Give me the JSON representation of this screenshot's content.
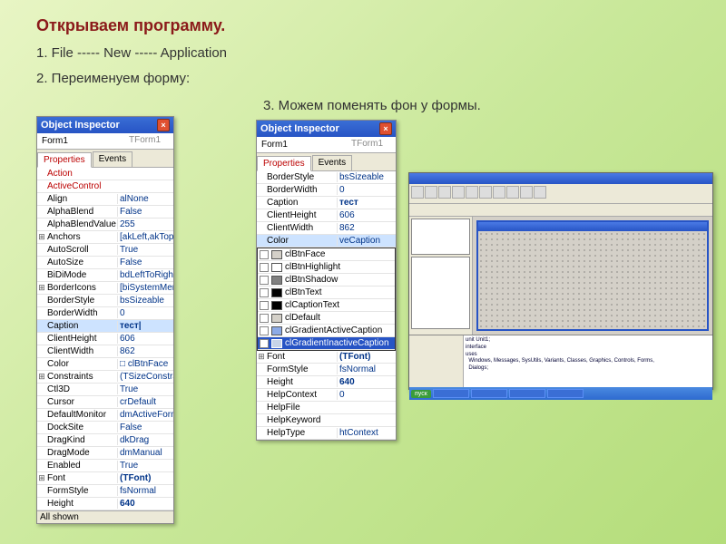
{
  "title": "Открываем программу.",
  "step1": "1.   File -----  New -----  Application",
  "step2": "2.   Переименуем форму:",
  "step3": "3.  Можем поменять фон у формы.",
  "oi1": {
    "title": "Object Inspector",
    "combo_name": "Form1",
    "combo_type": "TForm1",
    "tab_props": "Properties",
    "tab_events": "Events",
    "rows": [
      {
        "e": "",
        "n": "Action",
        "v": "",
        "red": true
      },
      {
        "e": "",
        "n": "ActiveControl",
        "v": "",
        "red": true
      },
      {
        "e": "",
        "n": "Align",
        "v": "alNone"
      },
      {
        "e": "",
        "n": "AlphaBlend",
        "v": "False"
      },
      {
        "e": "",
        "n": "AlphaBlendValue",
        "v": "255"
      },
      {
        "e": "⊞",
        "n": "Anchors",
        "v": "[akLeft,akTop]"
      },
      {
        "e": "",
        "n": "AutoScroll",
        "v": "True"
      },
      {
        "e": "",
        "n": "AutoSize",
        "v": "False"
      },
      {
        "e": "",
        "n": "BiDiMode",
        "v": "bdLeftToRight"
      },
      {
        "e": "⊞",
        "n": "BorderIcons",
        "v": "[biSystemMenu,"
      },
      {
        "e": "",
        "n": "BorderStyle",
        "v": "bsSizeable"
      },
      {
        "e": "",
        "n": "BorderWidth",
        "v": "0"
      },
      {
        "e": "",
        "n": "Caption",
        "v": "тест|",
        "sel": true,
        "bold": true
      },
      {
        "e": "",
        "n": "ClientHeight",
        "v": "606"
      },
      {
        "e": "",
        "n": "ClientWidth",
        "v": "862"
      },
      {
        "e": "",
        "n": "Color",
        "v": "□ clBtnFace"
      },
      {
        "e": "⊞",
        "n": "Constraints",
        "v": "(TSizeConstrain"
      },
      {
        "e": "",
        "n": "Ctl3D",
        "v": "True"
      },
      {
        "e": "",
        "n": "Cursor",
        "v": "crDefault"
      },
      {
        "e": "",
        "n": "DefaultMonitor",
        "v": "dmActiveForm"
      },
      {
        "e": "",
        "n": "DockSite",
        "v": "False"
      },
      {
        "e": "",
        "n": "DragKind",
        "v": "dkDrag"
      },
      {
        "e": "",
        "n": "DragMode",
        "v": "dmManual"
      },
      {
        "e": "",
        "n": "Enabled",
        "v": "True"
      },
      {
        "e": "⊞",
        "n": "Font",
        "v": "(TFont)",
        "bold": true
      },
      {
        "e": "",
        "n": "FormStyle",
        "v": "fsNormal"
      },
      {
        "e": "",
        "n": "Height",
        "v": "640",
        "bold": true
      }
    ],
    "status": "All shown"
  },
  "oi2": {
    "title": "Object Inspector",
    "combo_name": "Form1",
    "combo_type": "TForm1",
    "tab_props": "Properties",
    "tab_events": "Events",
    "rows": [
      {
        "e": "",
        "n": "BorderStyle",
        "v": "bsSizeable"
      },
      {
        "e": "",
        "n": "BorderWidth",
        "v": "0"
      },
      {
        "e": "",
        "n": "Caption",
        "v": "тест",
        "bold": true
      },
      {
        "e": "",
        "n": "ClientHeight",
        "v": "606"
      },
      {
        "e": "",
        "n": "ClientWidth",
        "v": "862"
      },
      {
        "e": "",
        "n": "Color",
        "v": "veCaption",
        "sel": true
      }
    ],
    "colors": [
      {
        "c": "#d4d0c8",
        "n": "clBtnFace"
      },
      {
        "c": "#ffffff",
        "n": "clBtnHighlight"
      },
      {
        "c": "#808080",
        "n": "clBtnShadow"
      },
      {
        "c": "#000000",
        "n": "clBtnText"
      },
      {
        "c": "#000000",
        "n": "clCaptionText"
      },
      {
        "c": "#d4d0c8",
        "n": "clDefault"
      },
      {
        "c": "#8caae6",
        "n": "clGradientActiveCaption"
      },
      {
        "c": "#c8d4e8",
        "n": "clGradientInactiveCaption",
        "sel": true
      }
    ],
    "rows2": [
      {
        "e": "⊞",
        "n": "Font",
        "v": "(TFont)",
        "bold": true
      },
      {
        "e": "",
        "n": "FormStyle",
        "v": "fsNormal"
      },
      {
        "e": "",
        "n": "Height",
        "v": "640",
        "bold": true
      },
      {
        "e": "",
        "n": "HelpContext",
        "v": "0"
      },
      {
        "e": "",
        "n": "HelpFile",
        "v": ""
      },
      {
        "e": "",
        "n": "HelpKeyword",
        "v": ""
      },
      {
        "e": "",
        "n": "HelpType",
        "v": "htContext"
      }
    ]
  },
  "ide": {
    "code": "unit Unit1;\ninterface\nuses\n  Windows, Messages, SysUtils, Variants, Classes, Graphics, Controls, Forms,\n  Dialogs;",
    "start": "пуск"
  }
}
